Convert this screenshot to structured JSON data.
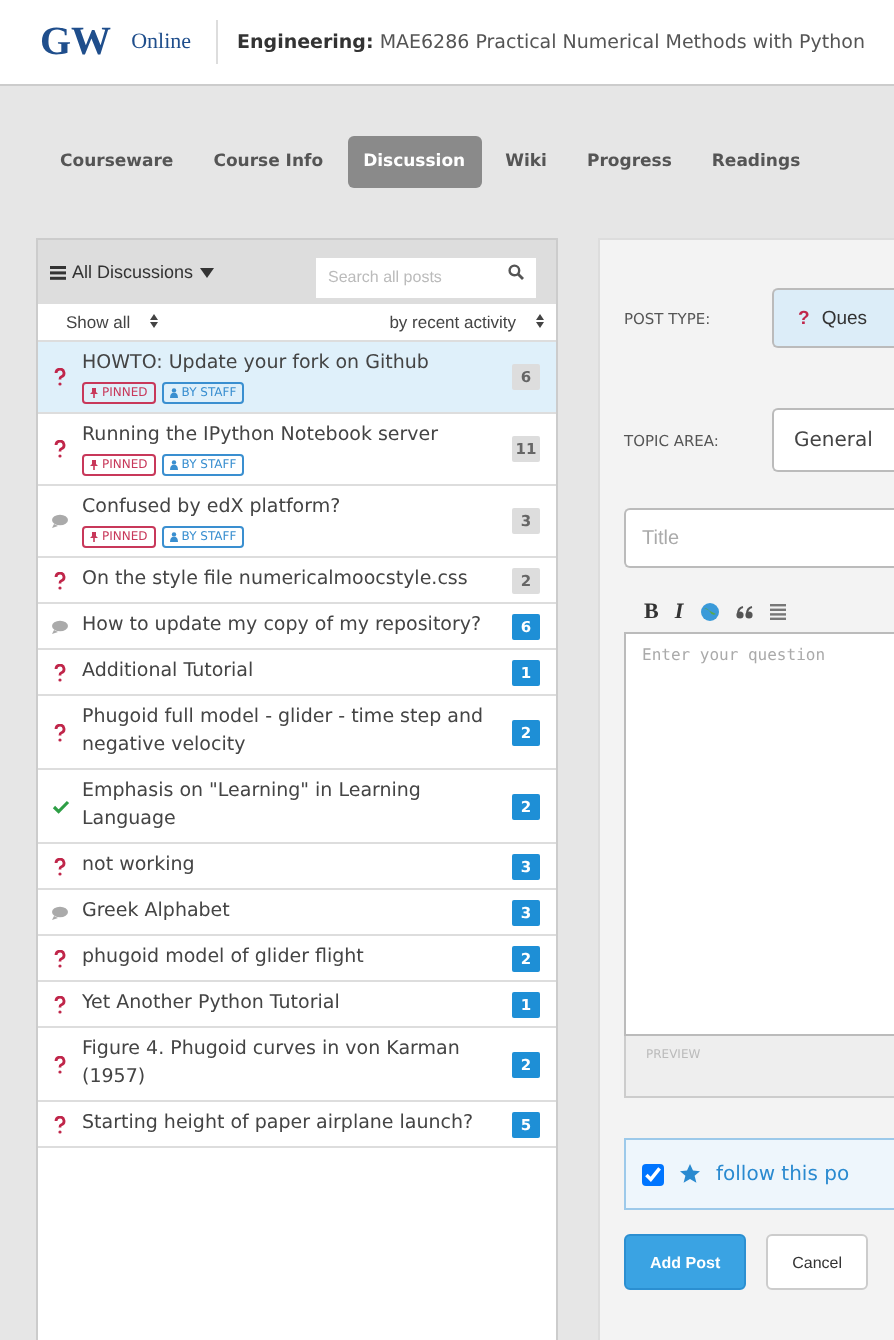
{
  "header": {
    "logo": "GW",
    "logo_sub": "Online",
    "course_prefix": "Engineering:",
    "course_title": "MAE6286 Practical Numerical Methods with Python"
  },
  "tabs": [
    {
      "label": "Courseware",
      "selected": false
    },
    {
      "label": "Course Info",
      "selected": false
    },
    {
      "label": "Discussion",
      "selected": true
    },
    {
      "label": "Wiki",
      "selected": false
    },
    {
      "label": "Progress",
      "selected": false
    },
    {
      "label": "Readings",
      "selected": false
    }
  ],
  "sidebar": {
    "filter": "All Discussions",
    "search": {
      "placeholder": "Search all posts"
    },
    "show": "Show all",
    "sort": "by recent activity"
  },
  "threads": [
    {
      "kind": "question",
      "title": "HOWTO: Update your fork on Github",
      "tags": [
        {
          "kind": "pinned",
          "label": "PINNED"
        },
        {
          "kind": "staff",
          "label": "BY STAFF"
        }
      ],
      "count": "6",
      "unread": false,
      "selected": true
    },
    {
      "kind": "question",
      "title": "Running the IPython Notebook server",
      "tags": [
        {
          "kind": "pinned",
          "label": "PINNED"
        },
        {
          "kind": "staff",
          "label": "BY STAFF"
        }
      ],
      "count": "11",
      "unread": false,
      "selected": false
    },
    {
      "kind": "discussion",
      "title": "Confused by edX platform?",
      "tags": [
        {
          "kind": "pinned",
          "label": "PINNED"
        },
        {
          "kind": "staff",
          "label": "BY STAFF"
        }
      ],
      "count": "3",
      "unread": false,
      "selected": false
    },
    {
      "kind": "question",
      "title": "On the style file numericalmoocstyle.css",
      "count": "2",
      "unread": false,
      "selected": false
    },
    {
      "kind": "discussion",
      "title": "How to update my copy of my repository?",
      "count": "6",
      "unread": true,
      "selected": false
    },
    {
      "kind": "question",
      "title": "Additional Tutorial",
      "count": "1",
      "unread": true,
      "selected": false
    },
    {
      "kind": "question",
      "title": "Phugoid full model - glider - time step and negative velocity",
      "count": "2",
      "unread": true,
      "selected": false
    },
    {
      "kind": "answered",
      "title": "Emphasis on \"Learning\" in Learning Language",
      "count": "2",
      "unread": true,
      "selected": false
    },
    {
      "kind": "question",
      "title": "not working",
      "count": "3",
      "unread": true,
      "selected": false
    },
    {
      "kind": "discussion",
      "title": "Greek Alphabet",
      "count": "3",
      "unread": true,
      "selected": false
    },
    {
      "kind": "question",
      "title": "phugoid model of glider flight",
      "count": "2",
      "unread": true,
      "selected": false
    },
    {
      "kind": "question",
      "title": "Yet Another Python Tutorial",
      "count": "1",
      "unread": true,
      "selected": false
    },
    {
      "kind": "question",
      "title": "Figure 4. Phugoid curves in von Karman (1957)",
      "count": "2",
      "unread": true,
      "selected": false
    },
    {
      "kind": "question",
      "title": "Starting height of paper airplane launch?",
      "count": "5",
      "unread": true,
      "selected": false
    }
  ],
  "form": {
    "post_type_label": "POST TYPE:",
    "post_type": {
      "icon": "?",
      "label": "Ques",
      "selected": true
    },
    "topic_label": "TOPIC AREA:",
    "topic": "General",
    "title": {
      "placeholder": "Title"
    },
    "toolbar": [
      {
        "kind": "bold",
        "label": "B"
      },
      {
        "kind": "italic",
        "label": "I"
      },
      {
        "kind": "link"
      },
      {
        "kind": "quote"
      },
      {
        "kind": "code"
      }
    ],
    "body": {
      "placeholder": "Enter your question"
    },
    "preview": "PREVIEW",
    "follow": {
      "checked": true,
      "label": "follow this po"
    },
    "buttons": [
      {
        "kind": "primary",
        "label": "Add Post"
      },
      {
        "kind": "secondary",
        "label": "Cancel"
      }
    ]
  }
}
